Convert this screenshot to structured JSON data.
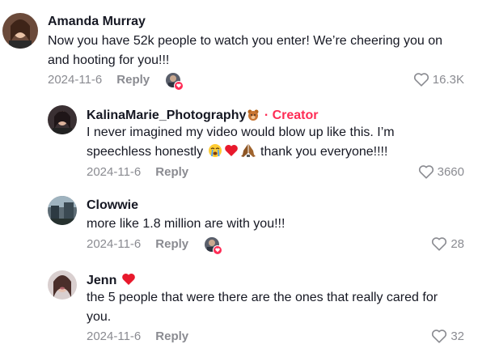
{
  "comments": [
    {
      "name": "Amanda Murray",
      "text": "Now you have 52k people to watch you enter! We’re cheering you on and hooting for you!!!",
      "date": "2024-11-6",
      "reply_label": "Reply",
      "likes": "16.3K",
      "liked_by_creator": true
    },
    {
      "name": "KalinaMarie_Photography",
      "name_emoji": "bear-icon",
      "creator_label": "· Creator",
      "text_part1": "I never imagined my video would blow up like this. I’m speechless honestly",
      "text_part2": "thank you everyone!!!!",
      "text_emojis": [
        "crying-face-icon",
        "red-heart-icon",
        "praying-hands-icon"
      ],
      "date": "2024-11-6",
      "reply_label": "Reply",
      "likes": "3660",
      "liked_by_creator": false
    },
    {
      "name": "Clowwie",
      "text": "more like 1.8 million are with you!!!",
      "date": "2024-11-6",
      "reply_label": "Reply",
      "likes": "28",
      "liked_by_creator": true
    },
    {
      "name": "Jenn",
      "name_emoji": "red-heart-icon",
      "text": "the 5 people that were there are the ones that really cared for you.",
      "date": "2024-11-6",
      "reply_label": "Reply",
      "likes": "32",
      "liked_by_creator": false
    }
  ],
  "colors": {
    "text": "#161823",
    "muted": "#8a8b91",
    "creator": "#fe2c55",
    "heart": "#e8192c"
  }
}
